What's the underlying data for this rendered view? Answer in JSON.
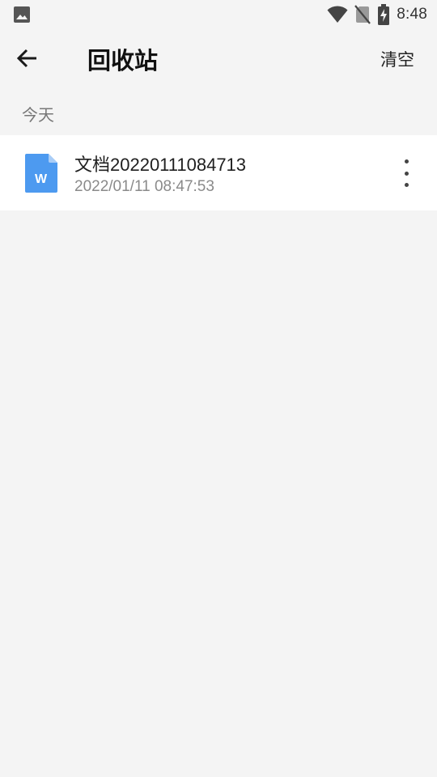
{
  "status_bar": {
    "time": "8:48",
    "icons": [
      "image-icon",
      "wifi-icon",
      "no-sim-icon",
      "battery-charging-icon"
    ]
  },
  "app_bar": {
    "back_icon": "arrow-left-icon",
    "title": "回收站",
    "clear_label": "清空"
  },
  "sections": [
    {
      "label": "今天",
      "items": [
        {
          "icon": "word-document-icon",
          "icon_letter": "W",
          "name": "文档20220111084713",
          "date": "2022/01/11 08:47:53",
          "more_icon": "more-vertical-icon"
        }
      ]
    }
  ],
  "colors": {
    "background": "#f4f4f4",
    "row_background": "#ffffff",
    "doc_icon_blue": "#4d9af0",
    "secondary_text": "#8a8a8a"
  }
}
